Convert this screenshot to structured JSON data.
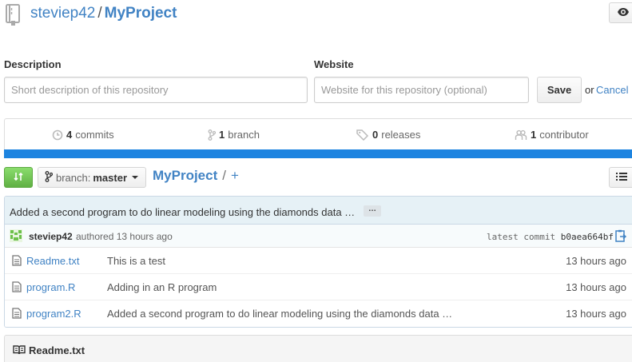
{
  "repo": {
    "owner": "steviep42",
    "separator": "/",
    "name": "MyProject"
  },
  "header": {
    "watch_icon": "eye-icon"
  },
  "form": {
    "description_label": "Description",
    "description_placeholder": "Short description of this repository",
    "website_label": "Website",
    "website_placeholder": "Website for this repository (optional)",
    "save_label": "Save",
    "or_text": "or",
    "cancel_label": "Cancel"
  },
  "stats": {
    "commits_count": "4",
    "commits_label": "commits",
    "branches_count": "1",
    "branches_label": "branch",
    "releases_count": "0",
    "releases_label": "releases",
    "contributors_count": "1",
    "contributors_label": "contributor"
  },
  "colors": {
    "language_bar": "#1d84e0",
    "compare_button": "#60b044",
    "link": "#4183c4"
  },
  "file_nav": {
    "branch_prefix": "branch:",
    "branch_name": "master",
    "breadcrumb_repo": "MyProject",
    "breadcrumb_sep": "/",
    "breadcrumb_add": "+"
  },
  "commit": {
    "message": "Added a second program to do linear modeling using the diamonds data …",
    "ellipsis": "…",
    "author": "steviep42",
    "meta": "authored 13 hours ago",
    "latest_label": "latest commit",
    "sha": "b0aea664bf"
  },
  "files": [
    {
      "name": "Readme.txt",
      "message": "This is a test",
      "age": "13 hours ago"
    },
    {
      "name": "program.R",
      "message": "Adding in an R program",
      "age": "13 hours ago"
    },
    {
      "name": "program2.R",
      "message": "Added a second program to do linear modeling using the diamonds data …",
      "age": "13 hours ago"
    }
  ],
  "readme": {
    "title": "Readme.txt",
    "icon": "book-icon"
  }
}
